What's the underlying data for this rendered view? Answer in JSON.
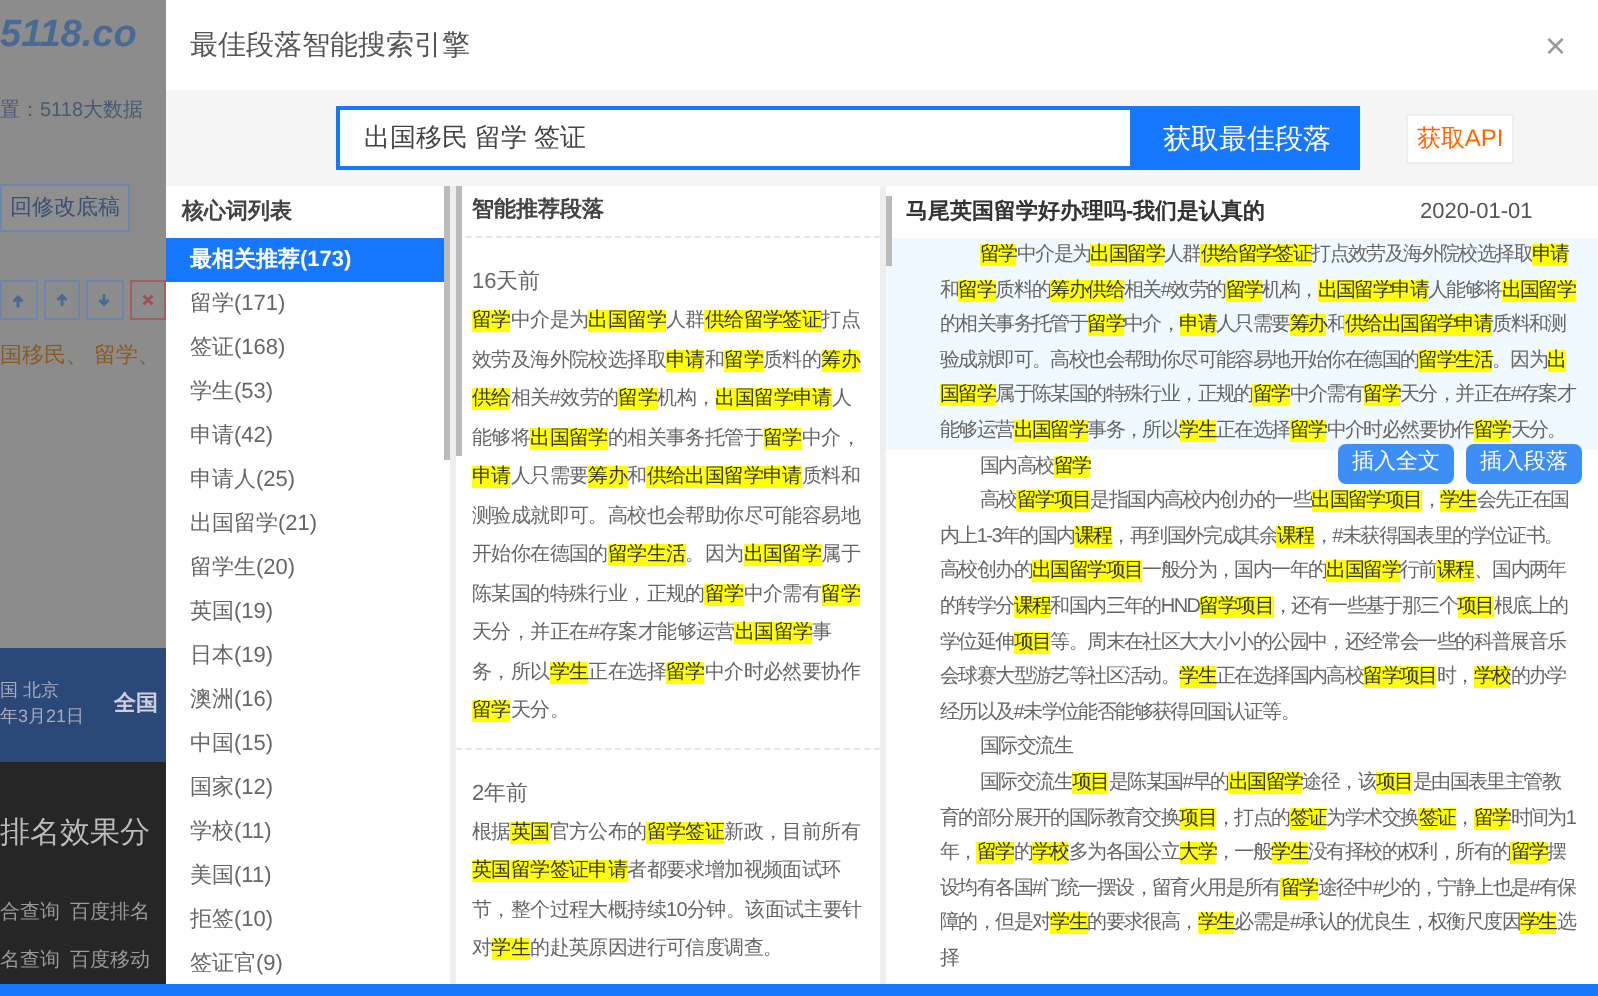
{
  "background_page": {
    "logo": "5118.co",
    "breadcrumb": "置：5118大数据",
    "back_button": "回修改底稿",
    "keywords": "国移民、 留学、",
    "banner_lines": [
      "国 北京",
      "年3月21日"
    ],
    "banner_side": "全国",
    "section_title": "排名效果分",
    "link_rows": [
      [
        "合查询",
        "百度排名"
      ],
      [
        "名查询",
        "百度移动"
      ]
    ]
  },
  "dialog": {
    "title": "最佳段落智能搜索引擎",
    "close": "×",
    "search": {
      "value": "出国移民 留学 签证",
      "button": "获取最佳段落"
    },
    "api_button": "获取API",
    "keyword_list": {
      "title": "核心词列表",
      "items": [
        {
          "label": "最相关推荐(173)",
          "selected": true
        },
        {
          "label": "留学(171)",
          "selected": false
        },
        {
          "label": "签证(168)",
          "selected": false
        },
        {
          "label": "学生(53)",
          "selected": false
        },
        {
          "label": "申请(42)",
          "selected": false
        },
        {
          "label": "申请人(25)",
          "selected": false
        },
        {
          "label": "出国留学(21)",
          "selected": false
        },
        {
          "label": "留学生(20)",
          "selected": false
        },
        {
          "label": "英国(19)",
          "selected": false
        },
        {
          "label": "日本(19)",
          "selected": false
        },
        {
          "label": "澳洲(16)",
          "selected": false
        },
        {
          "label": "中国(15)",
          "selected": false
        },
        {
          "label": "国家(12)",
          "selected": false
        },
        {
          "label": "学校(11)",
          "selected": false
        },
        {
          "label": "美国(11)",
          "selected": false
        },
        {
          "label": "拒签(10)",
          "selected": false
        },
        {
          "label": "签证官(9)",
          "selected": false
        }
      ]
    },
    "recommended": {
      "title": "智能推荐段落",
      "cards": [
        {
          "time": "16天前",
          "segments": [
            {
              "text": "留学",
              "highlighted": true
            },
            {
              "text": "中介是为",
              "highlighted": false
            },
            {
              "text": "出国留学",
              "highlighted": true
            },
            {
              "text": "人群",
              "highlighted": false
            },
            {
              "text": "供给留学签证",
              "highlighted": true
            },
            {
              "text": "打点效劳及海外院校选择取",
              "highlighted": false
            },
            {
              "text": "申请",
              "highlighted": true
            },
            {
              "text": "和",
              "highlighted": false
            },
            {
              "text": "留学",
              "highlighted": true
            },
            {
              "text": "质料的",
              "highlighted": false
            },
            {
              "text": "筹办供给",
              "highlighted": true
            },
            {
              "text": "相关#效劳的",
              "highlighted": false
            },
            {
              "text": "留学",
              "highlighted": true
            },
            {
              "text": "机构，",
              "highlighted": false
            },
            {
              "text": "出国留学申请",
              "highlighted": true
            },
            {
              "text": "人能够将",
              "highlighted": false
            },
            {
              "text": "出国留学",
              "highlighted": true
            },
            {
              "text": "的相关事务托管于",
              "highlighted": false
            },
            {
              "text": "留学",
              "highlighted": true
            },
            {
              "text": "中介，",
              "highlighted": false
            },
            {
              "text": "申请",
              "highlighted": true
            },
            {
              "text": "人只需要",
              "highlighted": false
            },
            {
              "text": "筹办",
              "highlighted": true
            },
            {
              "text": "和",
              "highlighted": false
            },
            {
              "text": "供给出国留学申请",
              "highlighted": true
            },
            {
              "text": "质料和测验成就即可。高校也会帮助你尽可能容易地开始你在德国的",
              "highlighted": false
            },
            {
              "text": "留学生活",
              "highlighted": true
            },
            {
              "text": "。因为",
              "highlighted": false
            },
            {
              "text": "出国留学",
              "highlighted": true
            },
            {
              "text": "属于陈某国的特殊行业，正规的",
              "highlighted": false
            },
            {
              "text": "留学",
              "highlighted": true
            },
            {
              "text": "中介需有",
              "highlighted": false
            },
            {
              "text": "留学",
              "highlighted": true
            },
            {
              "text": "天分，并正在#存案才能够运营",
              "highlighted": false
            },
            {
              "text": "出国留学",
              "highlighted": true
            },
            {
              "text": "事务，所以",
              "highlighted": false
            },
            {
              "text": "学生",
              "highlighted": true
            },
            {
              "text": "正在选择",
              "highlighted": false
            },
            {
              "text": "留学",
              "highlighted": true
            },
            {
              "text": "中介时必然要协作",
              "highlighted": false
            },
            {
              "text": "留学",
              "highlighted": true
            },
            {
              "text": "天分。",
              "highlighted": false
            }
          ]
        },
        {
          "time": "2年前",
          "segments": [
            {
              "text": "根据",
              "highlighted": false
            },
            {
              "text": "英国",
              "highlighted": true
            },
            {
              "text": "官方公布的",
              "highlighted": false
            },
            {
              "text": "留学签证",
              "highlighted": true
            },
            {
              "text": "新政，目前所有",
              "highlighted": false
            },
            {
              "text": "英国留学签证申请",
              "highlighted": true
            },
            {
              "text": "者都要求增加视频面试环节，整个过程大概持续10分钟。该面试主要针对",
              "highlighted": false
            },
            {
              "text": "学生",
              "highlighted": true
            },
            {
              "text": "的赴英原因进行可信度调查。",
              "highlighted": false
            }
          ]
        }
      ]
    },
    "article": {
      "title": "马尾英国留学好办理吗-我们是认真的",
      "date": "2020-01-01",
      "paragraphs": [
        {
          "selected": true,
          "segments": [
            {
              "text": "留学",
              "highlighted": true
            },
            {
              "text": "中介是为",
              "highlighted": false
            },
            {
              "text": "出国留学",
              "highlighted": true
            },
            {
              "text": "人群",
              "highlighted": false
            },
            {
              "text": "供给留学签证",
              "highlighted": true
            },
            {
              "text": "打点效劳及海外院校选择取",
              "highlighted": false
            },
            {
              "text": "申请",
              "highlighted": true
            },
            {
              "text": "和",
              "highlighted": false
            },
            {
              "text": "留学",
              "highlighted": true
            },
            {
              "text": "质料的",
              "highlighted": false
            },
            {
              "text": "筹办供给",
              "highlighted": true
            },
            {
              "text": "相关#效劳的",
              "highlighted": false
            },
            {
              "text": "留学",
              "highlighted": true
            },
            {
              "text": "机构，",
              "highlighted": false
            },
            {
              "text": "出国留学申请",
              "highlighted": true
            },
            {
              "text": "人能够将",
              "highlighted": false
            },
            {
              "text": "出国留学",
              "highlighted": true
            },
            {
              "text": "的相关事务托管于",
              "highlighted": false
            },
            {
              "text": "留学",
              "highlighted": true
            },
            {
              "text": "中介，",
              "highlighted": false
            },
            {
              "text": "申请",
              "highlighted": true
            },
            {
              "text": "人只需要",
              "highlighted": false
            },
            {
              "text": "筹办",
              "highlighted": true
            },
            {
              "text": "和",
              "highlighted": false
            },
            {
              "text": "供给出国留学申请",
              "highlighted": true
            },
            {
              "text": "质料和测验成就即可。高校也会帮助你尽可能容易地开始你在德国的",
              "highlighted": false
            },
            {
              "text": "留学生活",
              "highlighted": true
            },
            {
              "text": "。因为",
              "highlighted": false
            },
            {
              "text": "出国留学",
              "highlighted": true
            },
            {
              "text": "属于陈某国的特殊行业，正规的",
              "highlighted": false
            },
            {
              "text": "留学",
              "highlighted": true
            },
            {
              "text": "中介需有",
              "highlighted": false
            },
            {
              "text": "留学",
              "highlighted": true
            },
            {
              "text": "天分，并正在#存案才能够运营",
              "highlighted": false
            },
            {
              "text": "出国留学",
              "highlighted": true
            },
            {
              "text": "事务，所以",
              "highlighted": false
            },
            {
              "text": "学生",
              "highlighted": true
            },
            {
              "text": "正在选择",
              "highlighted": false
            },
            {
              "text": "留学",
              "highlighted": true
            },
            {
              "text": "中介时必然要协作",
              "highlighted": false
            },
            {
              "text": "留学",
              "highlighted": true
            },
            {
              "text": "天分。",
              "highlighted": false
            }
          ]
        },
        {
          "selected": false,
          "segments": [
            {
              "text": "国内高校",
              "highlighted": false
            },
            {
              "text": "留学",
              "highlighted": true
            }
          ]
        },
        {
          "selected": false,
          "segments": [
            {
              "text": "高校",
              "highlighted": false
            },
            {
              "text": "留学项目",
              "highlighted": true
            },
            {
              "text": "是指国内高校内创办的一些",
              "highlighted": false
            },
            {
              "text": "出国留学项目",
              "highlighted": true
            },
            {
              "text": "，",
              "highlighted": false
            },
            {
              "text": "学生",
              "highlighted": true
            },
            {
              "text": "会先正在国内上1-3年的国内",
              "highlighted": false
            },
            {
              "text": "课程",
              "highlighted": true
            },
            {
              "text": "，再到国外完成其余",
              "highlighted": false
            },
            {
              "text": "课程",
              "highlighted": true
            },
            {
              "text": "，#未获得国表里的学位证书。高校创办的",
              "highlighted": false
            },
            {
              "text": "出国留学项目",
              "highlighted": true
            },
            {
              "text": "一般分为，国内一年的",
              "highlighted": false
            },
            {
              "text": "出国留学",
              "highlighted": true
            },
            {
              "text": "行前",
              "highlighted": false
            },
            {
              "text": "课程",
              "highlighted": true
            },
            {
              "text": "、国内两年的转学分",
              "highlighted": false
            },
            {
              "text": "课程",
              "highlighted": true
            },
            {
              "text": "和国内三年的HND",
              "highlighted": false
            },
            {
              "text": "留学项目",
              "highlighted": true
            },
            {
              "text": "，还有一些基于那三个",
              "highlighted": false
            },
            {
              "text": "项目",
              "highlighted": true
            },
            {
              "text": "根底上的学位延伸",
              "highlighted": false
            },
            {
              "text": "项目",
              "highlighted": true
            },
            {
              "text": "等。周末在社区大大小小的公园中，还经常会一些的科普展音乐会球赛大型游艺等社区活动。",
              "highlighted": false
            },
            {
              "text": "学生",
              "highlighted": true
            },
            {
              "text": "正在选择国内高校",
              "highlighted": false
            },
            {
              "text": "留学项目",
              "highlighted": true
            },
            {
              "text": "时，",
              "highlighted": false
            },
            {
              "text": "学校",
              "highlighted": true
            },
            {
              "text": "的办学经历以及#未学位能否能够获得回国认证等。",
              "highlighted": false
            }
          ]
        },
        {
          "selected": false,
          "segments": [
            {
              "text": "国际交流生",
              "highlighted": false
            }
          ]
        },
        {
          "selected": false,
          "segments": [
            {
              "text": "国际交流生",
              "highlighted": false
            },
            {
              "text": "项目",
              "highlighted": true
            },
            {
              "text": "是陈某国#早的",
              "highlighted": false
            },
            {
              "text": "出国留学",
              "highlighted": true
            },
            {
              "text": "途径，该",
              "highlighted": false
            },
            {
              "text": "项目",
              "highlighted": true
            },
            {
              "text": "是由国表里主管教育的部分展开的国际教育交换",
              "highlighted": false
            },
            {
              "text": "项目",
              "highlighted": true
            },
            {
              "text": "，打点的",
              "highlighted": false
            },
            {
              "text": "签证",
              "highlighted": true
            },
            {
              "text": "为学术交换",
              "highlighted": false
            },
            {
              "text": "签证",
              "highlighted": true
            },
            {
              "text": "，",
              "highlighted": false
            },
            {
              "text": "留学",
              "highlighted": true
            },
            {
              "text": "时间为1年，",
              "highlighted": false
            },
            {
              "text": "留学",
              "highlighted": true
            },
            {
              "text": "的",
              "highlighted": false
            },
            {
              "text": "学校",
              "highlighted": true
            },
            {
              "text": "多为各国公立",
              "highlighted": false
            },
            {
              "text": "大学",
              "highlighted": true
            },
            {
              "text": "，一般",
              "highlighted": false
            },
            {
              "text": "学生",
              "highlighted": true
            },
            {
              "text": "没有择校的权利，所有的",
              "highlighted": false
            },
            {
              "text": "留学",
              "highlighted": true
            },
            {
              "text": "摆设均有各国#门统一摆设，留育火用是所有",
              "highlighted": false
            },
            {
              "text": "留学",
              "highlighted": true
            },
            {
              "text": "途径中#少的，宁静上也是#有保障的，但是对",
              "highlighted": false
            },
            {
              "text": "学生",
              "highlighted": true
            },
            {
              "text": "的要求很高，",
              "highlighted": false
            },
            {
              "text": "学生",
              "highlighted": true
            },
            {
              "text": "必需是#承认的优良生，权衡尺度因",
              "highlighted": false
            },
            {
              "text": "学生",
              "highlighted": true
            },
            {
              "text": "选择",
              "highlighted": false
            }
          ]
        }
      ],
      "paragraph_actions": [
        "插入全文",
        "插入段落"
      ]
    }
  }
}
